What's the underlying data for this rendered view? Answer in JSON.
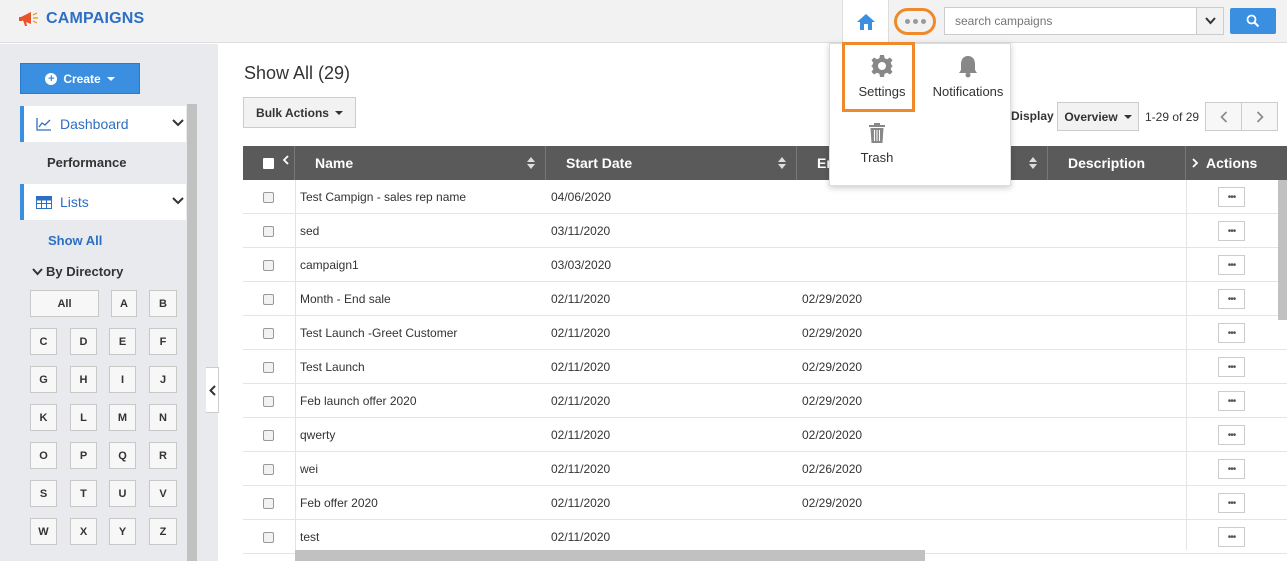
{
  "brand": {
    "title": "CAMPAIGNS"
  },
  "search": {
    "placeholder": "search campaigns"
  },
  "sidebar": {
    "create_label": "Create",
    "dashboard_label": "Dashboard",
    "performance_label": "Performance",
    "lists_label": "Lists",
    "show_all_label": "Show All",
    "by_directory_label": "By Directory",
    "letters": [
      "All",
      "A",
      "B",
      "C",
      "D",
      "E",
      "F",
      "G",
      "H",
      "I",
      "J",
      "K",
      "L",
      "M",
      "N",
      "O",
      "P",
      "Q",
      "R",
      "S",
      "T",
      "U",
      "V",
      "W",
      "X",
      "Y",
      "Z"
    ]
  },
  "main": {
    "title": "Show All (29)",
    "bulk_actions_label": "Bulk Actions",
    "display_label": "Display",
    "view_selected": "Overview",
    "page_info": "1-29 of 29"
  },
  "table": {
    "headers": {
      "name": "Name",
      "start_date": "Start Date",
      "end_date": "End Date",
      "description": "Description",
      "actions": "Actions"
    },
    "rows": [
      {
        "name": "Test Campign - sales rep name",
        "start": "04/06/2020",
        "end": ""
      },
      {
        "name": "sed",
        "start": "03/11/2020",
        "end": ""
      },
      {
        "name": "campaign1",
        "start": "03/03/2020",
        "end": ""
      },
      {
        "name": "Month - End sale",
        "start": "02/11/2020",
        "end": "02/29/2020"
      },
      {
        "name": "Test Launch -Greet Customer",
        "start": "02/11/2020",
        "end": "02/29/2020"
      },
      {
        "name": "Test Launch",
        "start": "02/11/2020",
        "end": "02/29/2020"
      },
      {
        "name": "Feb launch offer 2020",
        "start": "02/11/2020",
        "end": "02/29/2020"
      },
      {
        "name": "qwerty",
        "start": "02/11/2020",
        "end": "02/20/2020"
      },
      {
        "name": "wei",
        "start": "02/11/2020",
        "end": "02/26/2020"
      },
      {
        "name": "Feb offer 2020",
        "start": "02/11/2020",
        "end": "02/29/2020"
      },
      {
        "name": "test",
        "start": "02/11/2020",
        "end": ""
      }
    ]
  },
  "menu": {
    "settings_label": "Settings",
    "notifications_label": "Notifications",
    "trash_label": "Trash"
  },
  "colors": {
    "accent": "#3b8fe0",
    "highlight": "#ee8a2c",
    "header": "#5a5a5a"
  }
}
